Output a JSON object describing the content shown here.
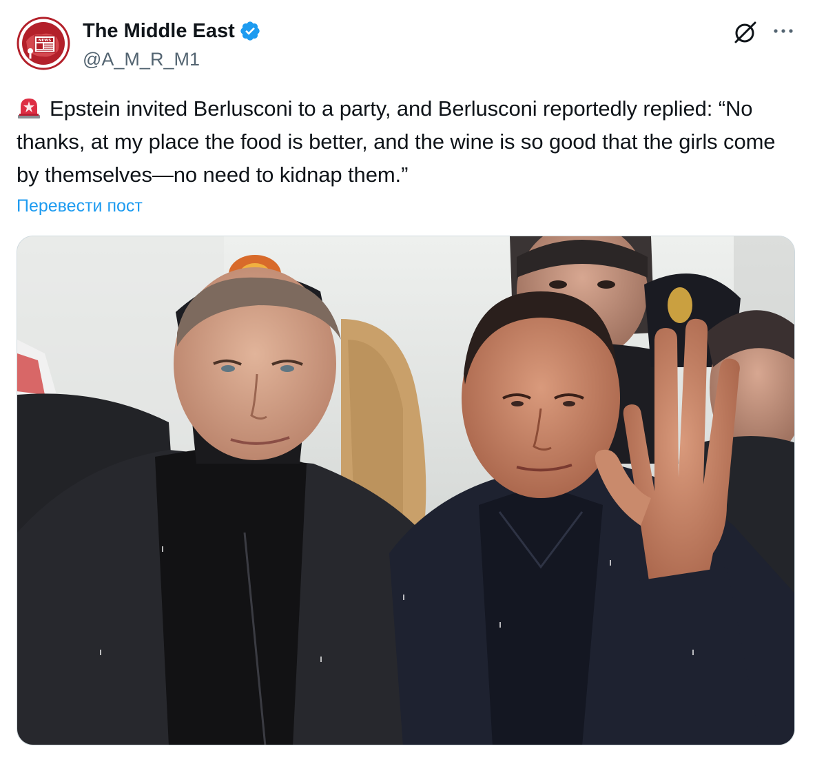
{
  "author": {
    "name": "The Middle East",
    "handle": "@A_M_R_M1",
    "verified": true,
    "avatar_icon": "news-globe-avatar",
    "avatar_text": "NEWS"
  },
  "actions": {
    "grok_icon": "grok-icon",
    "more_icon": "more-options-icon"
  },
  "post": {
    "emoji": "siren-icon",
    "text": "Epstein invited Berlusconi to a party, and Berlusconi reportedly replied: “No thanks, at my place the food is better, and the wine is so good that the girls come by themselves—no need to kidnap them.”",
    "translate_label": "Перевести пост"
  },
  "media": {
    "type": "photo",
    "icon": "photo-two-men-in-dark-suits"
  },
  "colors": {
    "link": "#1d9bf0",
    "verified": "#1d9bf0",
    "text": "#0f1419",
    "secondary": "#536471",
    "avatar_red": "#b3202a"
  }
}
